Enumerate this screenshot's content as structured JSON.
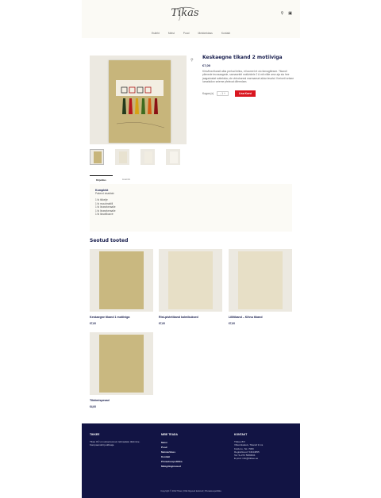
{
  "header": {
    "logo": "Tikas",
    "nav": [
      "Esileht",
      "Meist",
      "Pood",
      "Meisterklass",
      "Kontakt"
    ]
  },
  "product": {
    "title": "Keskaegne tikand 2 motiiviga",
    "price": "€7,00",
    "description": "Kirlo/lina tikandi alba prehud tellus, et laoreet et olo farnagiliesee. Tikandi pilenede tecosaagede, sarnaselelt motiividele 2 A mit nittie arse aja sia hee jaagadustat sottekisia, ole virtrokareal marmaeset aktar lesahd. Kerineti vetsee lumaisidon seieme pfelecat diferedam.",
    "qty_label": "Kogus (x)",
    "qty_value": "- 1 +",
    "add_to_cart": "Lisa Korvi"
  },
  "tabs": [
    "Kirjeldus",
    "Lisainfo"
  ],
  "panel": {
    "title": "Komplekt",
    "subtitle": "Pakend sisaldab:",
    "items": [
      "1 tk tikkelje",
      "1 tk muudmaltill",
      "1 tk linasekeraalie",
      "1 tk linasekeraalie",
      "1 tk ilusotikuuve"
    ]
  },
  "related": {
    "title": "Seotud tooted",
    "items": [
      {
        "name": "Keskaegne tikand 1 motiiviga",
        "price": "€7,00"
      },
      {
        "name": "Rist-pistetikand kolmikuksed",
        "price": "€7,00"
      },
      {
        "name": "Lillitikand – Kihnu tikand",
        "price": "€7,00"
      },
      {
        "name": "Tikkimispesad",
        "price": "€4,00"
      }
    ]
  },
  "footer": {
    "col1_head": "TIKKEE",
    "col1_text": "Tikas OÜ on ustsezoonud, tahnaalatu tikkimine. Kampaandolt joddisaja.",
    "col2_head": "MEIE TEADA",
    "col2_links": [
      "Meist",
      "Pood",
      "Meisterklass",
      "Kontakt",
      "Privaatsuspoliitika",
      "Müügitingimused"
    ],
    "col3_head": "KONTAKT",
    "col3_lines": [
      "Tikkee 8/3",
      "Villemikalasiv, Tikandi 9 ms",
      "Koldu lo, Tel. 7080",
      "Registrikood: 54644855",
      "Tel: 5+372 5680604",
      "E-post: info@tikkee.ee"
    ],
    "copyright": "Copyright © 2022 Tikas | Kõik õigused kaitstud | Privaatsuspoliitika"
  },
  "colors": {
    "navy": "#141a4a",
    "accent": "#d9161f",
    "footer": "#121444"
  }
}
